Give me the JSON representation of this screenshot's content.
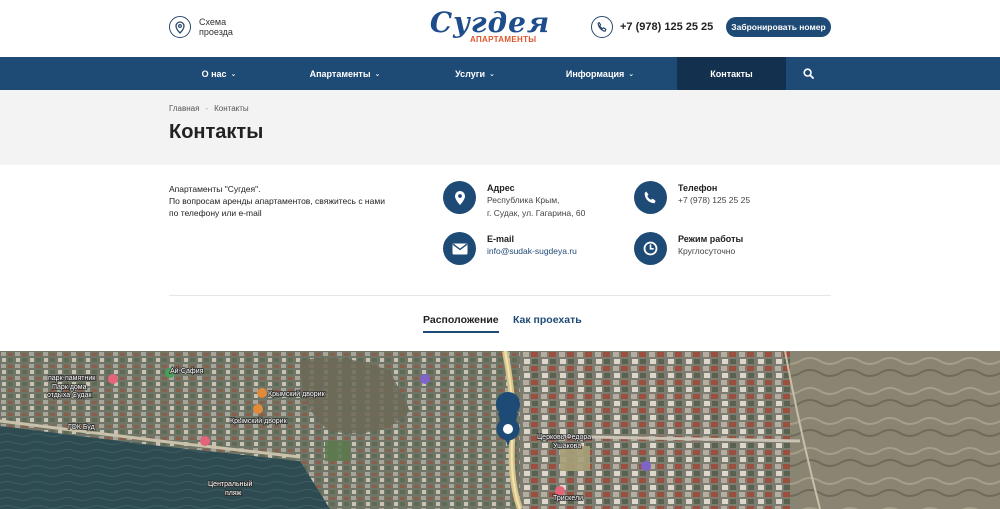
{
  "header": {
    "route_label": "Схема проезда",
    "logo_script": "Сугдея",
    "logo_sub": "АПАРТАМЕНТЫ",
    "phone": "+7 (978) 125 25 25",
    "book_button": "Забронировать номер"
  },
  "nav": {
    "items": [
      {
        "label": "О нас",
        "has_dropdown": true
      },
      {
        "label": "Апартаменты",
        "has_dropdown": true
      },
      {
        "label": "Услуги",
        "has_dropdown": true
      },
      {
        "label": "Информация",
        "has_dropdown": true
      },
      {
        "label": "Контакты",
        "has_dropdown": false,
        "active": true
      }
    ],
    "search_icon": "search-icon"
  },
  "breadcrumbs": [
    "Главная",
    "Контакты"
  ],
  "page_title": "Контакты",
  "intro": {
    "line1": "Апартаменты \"Сугдея\".",
    "line2": "По вопросам аренды апартаментов, свяжитесь с нами",
    "line3": "по телефону или e-mail"
  },
  "contacts": {
    "address": {
      "title": "Адрес",
      "line1": "Республика Крым,",
      "line2": "г. Судак, ул. Гагарина, 60",
      "icon": "map-pin-icon"
    },
    "phone": {
      "title": "Телефон",
      "value": "+7 (978) 125 25 25",
      "icon": "phone-icon"
    },
    "email": {
      "title": "E-mail",
      "value": "info@sudak-sugdeya.ru",
      "icon": "envelope-icon"
    },
    "hours": {
      "title": "Режим работы",
      "value": "Круглосуточно",
      "icon": "clock-icon"
    }
  },
  "tabs": [
    {
      "label": "Расположение",
      "active": true
    },
    {
      "label": "Как проехать",
      "active": false
    }
  ],
  "map": {
    "labels": {
      "l1": "парк-памятник",
      "l2": "Парк дома",
      "l3": "отдыха Судак",
      "l4": "Ай-Сафия",
      "l5": "Крымский дворик",
      "l6": "Крымский дворик",
      "l7": "ГОК Буд",
      "l8": "Церковь Федора",
      "l9": "Ушакова",
      "l10": "Центральный",
      "l11": "пляж",
      "l12": "Трискели"
    }
  },
  "colors": {
    "primary": "#1e4a76",
    "nav_active": "#14304f",
    "logo_orange": "#e0562b"
  }
}
